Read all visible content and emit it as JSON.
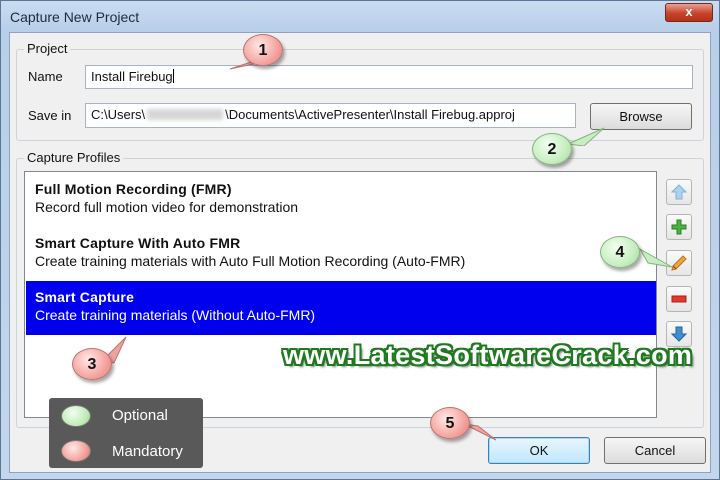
{
  "window": {
    "title": "Capture New Project",
    "close_glyph": "x"
  },
  "project": {
    "legend": "Project",
    "name_label": "Name",
    "name_value": "Install Firebug",
    "savein_label": "Save in",
    "savein_prefix": "C:\\Users\\",
    "savein_suffix": "\\Documents\\ActivePresenter\\Install Firebug.approj",
    "browse_label": "Browse"
  },
  "capture_profiles": {
    "legend": "Capture Profiles",
    "items": [
      {
        "title": "Full Motion Recording (FMR)",
        "description": "Record full motion video for demonstration"
      },
      {
        "title": "Smart Capture With Auto FMR",
        "description": "Create training materials with Auto Full Motion Recording (Auto-FMR)"
      },
      {
        "title": "Smart Capture",
        "description": "Create training materials (Without Auto-FMR)"
      }
    ],
    "selected_index": 2,
    "side_buttons": [
      "arrow-up-icon",
      "plus-icon",
      "pencil-icon",
      "minus-icon",
      "arrow-down-icon"
    ]
  },
  "footer": {
    "ok_label": "OK",
    "cancel_label": "Cancel"
  },
  "callouts": [
    "1",
    "2",
    "3",
    "4",
    "5"
  ],
  "legend": {
    "optional_label": "Optional",
    "mandatory_label": "Mandatory"
  },
  "watermark": "www.LatestSoftwareCrack.com",
  "colors": {
    "selection": "#0000ee",
    "callout_mandatory": "#f5a4a0",
    "callout_optional": "#c7eec0",
    "watermark_outline": "#1f7a1f"
  }
}
